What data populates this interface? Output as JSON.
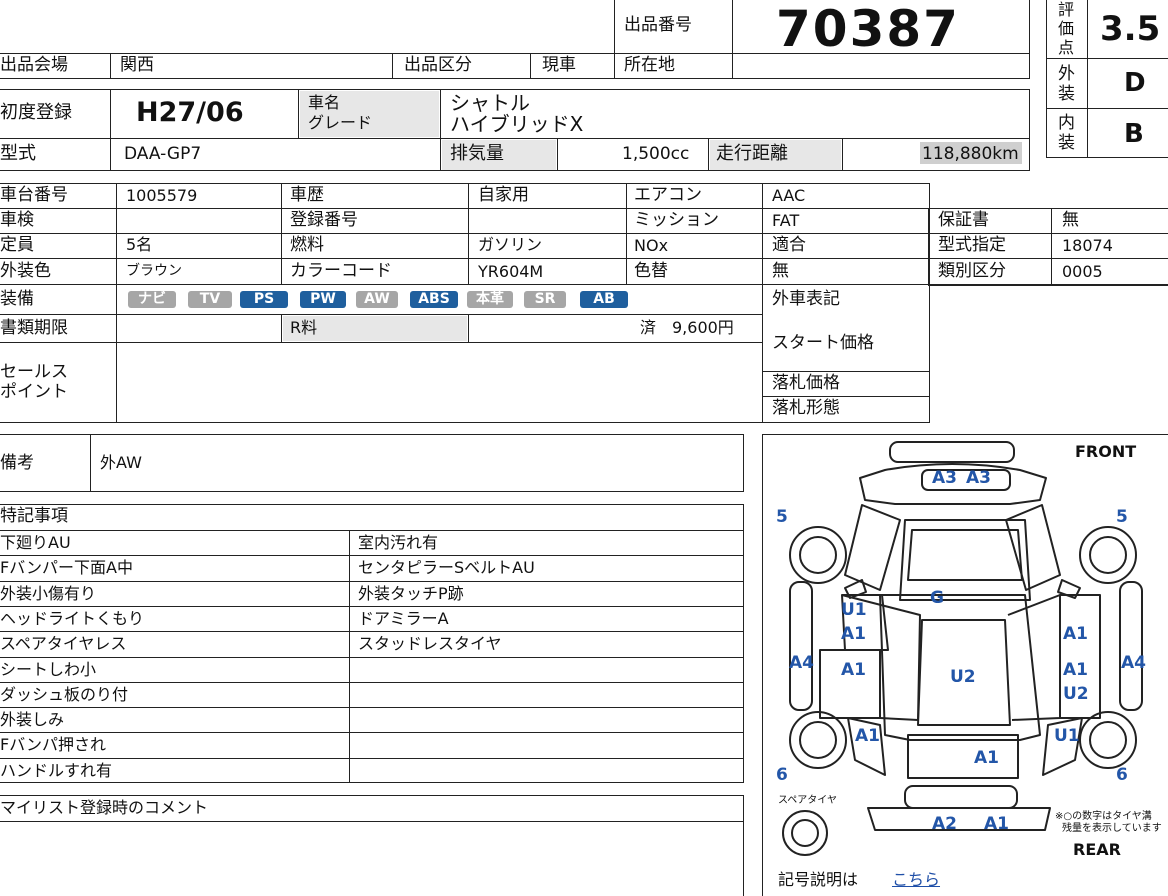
{
  "header": {
    "lot_label": "出品番号",
    "lot_number": "70387",
    "score_label": "評価点",
    "score": "3.5",
    "exterior_label": "外装",
    "exterior_grade": "D",
    "interior_label": "内装",
    "interior_grade": "B"
  },
  "venue": {
    "venue_label": "出品会場",
    "venue": "関西",
    "category_label": "出品区分",
    "category": "現車",
    "location_label": "所在地",
    "location": ""
  },
  "vehicle": {
    "first_reg_label": "初度登録",
    "first_reg": "H27/06",
    "name_label": "車名",
    "grade_label": "グレード",
    "name_line1": "シャトル",
    "name_line2": "ハイブリッドX",
    "model_label": "型式",
    "model": "DAA-GP7",
    "displacement_label": "排気量",
    "displacement": "1,500cc",
    "mileage_label": "走行距離",
    "mileage": "118,880km"
  },
  "details": {
    "chassis_label": "車台番号",
    "chassis": "1005579",
    "history_label": "車歴",
    "history": "自家用",
    "ac_label": "エアコン",
    "ac": "AAC",
    "inspection_label": "車検",
    "inspection": "",
    "regno_label": "登録番号",
    "regno": "",
    "transmission_label": "ミッション",
    "transmission": "FAT",
    "warranty_label": "保証書",
    "warranty": "無",
    "capacity_label": "定員",
    "capacity": "5名",
    "fuel_label": "燃料",
    "fuel": "ガソリン",
    "nox_label": "NOx",
    "nox": "適合",
    "type_designation_label": "型式指定",
    "type_designation": "18074",
    "color_label": "外装色",
    "color": "ブラウン",
    "color_code_label": "カラーコード",
    "color_code": "YR604M",
    "color_change_label": "色替",
    "color_change": "無",
    "class_label": "類別区分",
    "class_value": "0005",
    "equipment_label": "装備",
    "equipment": [
      {
        "label": "ナビ",
        "active": false
      },
      {
        "label": "TV",
        "active": false
      },
      {
        "label": "PS",
        "active": true
      },
      {
        "label": "PW",
        "active": true
      },
      {
        "label": "AW",
        "active": false
      },
      {
        "label": "ABS",
        "active": true
      },
      {
        "label": "本革",
        "active": false
      },
      {
        "label": "SR",
        "active": false
      },
      {
        "label": "AB",
        "active": true
      }
    ],
    "exterior_notation_label": "外車表記",
    "docs_label": "書類期限",
    "recycle_label": "R料",
    "recycle_value": "済　9,600円",
    "start_price_label": "スタート価格",
    "sales_label_line1": "セールス",
    "sales_label_line2": "ポイント",
    "winning_price_label": "落札価格",
    "winning_form_label": "落札形態"
  },
  "remarks": {
    "label": "備考",
    "value": "外AW"
  },
  "notes": {
    "label": "特記事項",
    "left": [
      "下廻りAU",
      "Fバンパー下面A中",
      "外装小傷有り",
      "ヘッドライトくもり",
      "スペアタイヤレス",
      "シートしわ小",
      "ダッシュ板のり付",
      "外装しみ",
      "Fバンパ押され",
      "ハンドルすれ有"
    ],
    "right": [
      "室内汚れ有",
      "センタピラーSベルトAU",
      "外装タッチP跡",
      "ドアミラーA",
      "スタッドレスタイヤ"
    ]
  },
  "mylist_label": "マイリスト登録時のコメント",
  "diagram": {
    "front_label": "FRONT",
    "rear_label": "REAR",
    "spare_label": "スペアタイヤ",
    "tread_note_line1": "※○の数字はタイヤ溝",
    "tread_note_line2": "残量を表示しています",
    "tread_fl": "5",
    "tread_fr": "5",
    "tread_rl": "6",
    "tread_rr": "6",
    "marks": {
      "front_bumper_1": "A3",
      "front_bumper_2": "A3",
      "glass": "G",
      "left_front_door_1": "U1",
      "left_front_door_2": "A1",
      "left_rear_door": "A1",
      "left_sill": "A4",
      "left_rear_fender": "A1",
      "roof": "U2",
      "right_front_door": "A1",
      "right_rear_door_1": "A1",
      "right_rear_door_2": "U2",
      "right_sill": "A4",
      "right_rear_fender": "U1",
      "trunk": "A1",
      "rear_bumper_1": "A2",
      "rear_bumper_2": "A1"
    },
    "legend_text": "記号説明は",
    "legend_link": "こちら"
  }
}
